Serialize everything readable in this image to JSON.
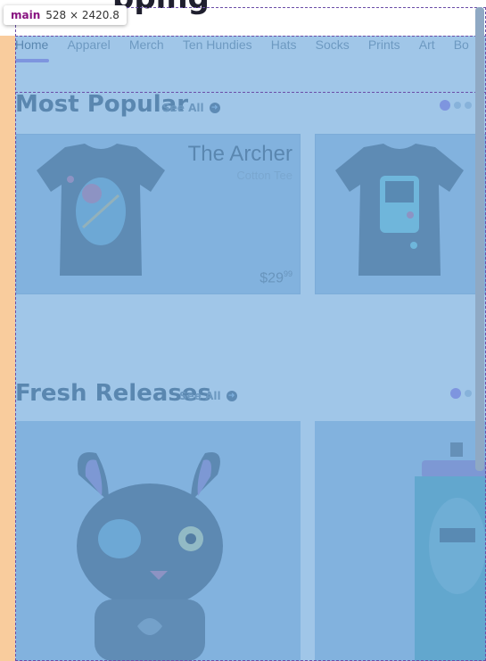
{
  "header": {
    "title": "pping"
  },
  "nav": {
    "items": [
      {
        "label": "Home",
        "active": true
      },
      {
        "label": "Apparel"
      },
      {
        "label": "Merch"
      },
      {
        "label": "Ten Hundies"
      },
      {
        "label": "Hats"
      },
      {
        "label": "Socks"
      },
      {
        "label": "Prints"
      },
      {
        "label": "Art"
      },
      {
        "label": "Bo"
      }
    ]
  },
  "most_popular": {
    "title": "Most Popular",
    "see_all": "See All",
    "card": {
      "name": "The Archer",
      "subtitle": "Cotton Tee",
      "price_dollars": "$29",
      "price_cents": "99"
    }
  },
  "fresh_releases": {
    "title": "Fresh Releases",
    "see_all": "See All"
  },
  "devtools": {
    "tag": "main",
    "dimensions": "528 × 2420.8"
  },
  "colors": {
    "accent": "#9b6fe3",
    "highlight_content": "#6fa8dc",
    "highlight_padding": "#f6b26b"
  }
}
